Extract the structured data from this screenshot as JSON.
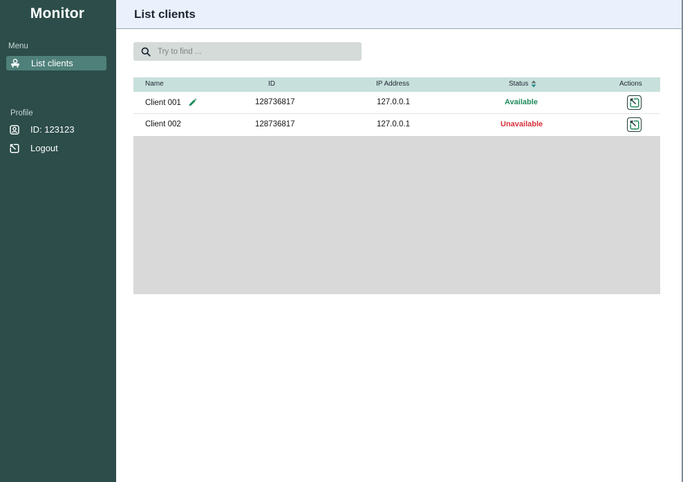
{
  "sidebar": {
    "brand": "Monitor",
    "menu_label": "Menu",
    "menu_items": [
      {
        "label": "List clients",
        "icon": "clients-icon",
        "active": true
      }
    ],
    "profile_label": "Profile",
    "profile_items": [
      {
        "label": "ID: 123123",
        "icon": "user-badge-icon"
      },
      {
        "label": "Logout",
        "icon": "logout-icon"
      }
    ]
  },
  "header": {
    "title": "List clients"
  },
  "search": {
    "placeholder": "Try to find ...",
    "icon": "search-icon"
  },
  "table": {
    "columns": [
      "Name",
      "ID",
      "IP Address",
      "Status",
      "Actions"
    ],
    "rows": [
      {
        "name": "Client 001",
        "id": "128736817",
        "ip": "127.0.0.1",
        "status": "Available",
        "editable": true
      },
      {
        "name": "Client 002",
        "id": "128736817",
        "ip": "127.0.0.1",
        "status": "Unavailable",
        "editable": false
      }
    ]
  },
  "colors": {
    "sidebar_bg": "#2c4d4a",
    "active_item_bg": "#4f807a",
    "header_bg": "#eaf1fd",
    "table_header_bg": "#c8e0dc",
    "available": "#1f8a5a",
    "unavailable": "#d6303a",
    "accent_green": "#1f8a5a"
  }
}
